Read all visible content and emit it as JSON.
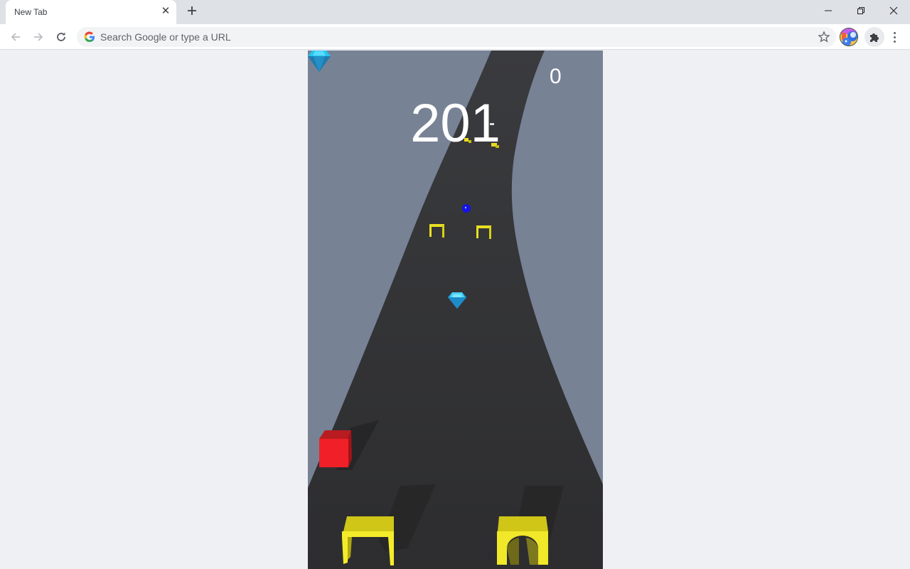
{
  "browser": {
    "tab": {
      "title": "New Tab",
      "close_icon": "close-icon"
    },
    "new_tab_icon": "plus-icon",
    "window_controls": {
      "minimize": "minimize-icon",
      "restore": "restore-icon",
      "close": "close-icon"
    },
    "toolbar": {
      "back_icon": "arrow-left-icon",
      "forward_icon": "arrow-right-icon",
      "reload_icon": "reload-icon",
      "omnibox": {
        "value": "",
        "placeholder": "Search Google or type a URL"
      },
      "bookmark_icon": "star-icon",
      "extensions_icon": "puzzle-icon",
      "menu_icon": "kebab-menu-icon"
    }
  },
  "game": {
    "score": "201",
    "gem_count": "0",
    "colors": {
      "background": "#778295",
      "road": "#2e2e30",
      "obstacle_yellow": "#e6e020",
      "cube_red": "#f0202a",
      "gem_blue": "#29c4f0",
      "ball_blue": "#1010e0"
    }
  }
}
